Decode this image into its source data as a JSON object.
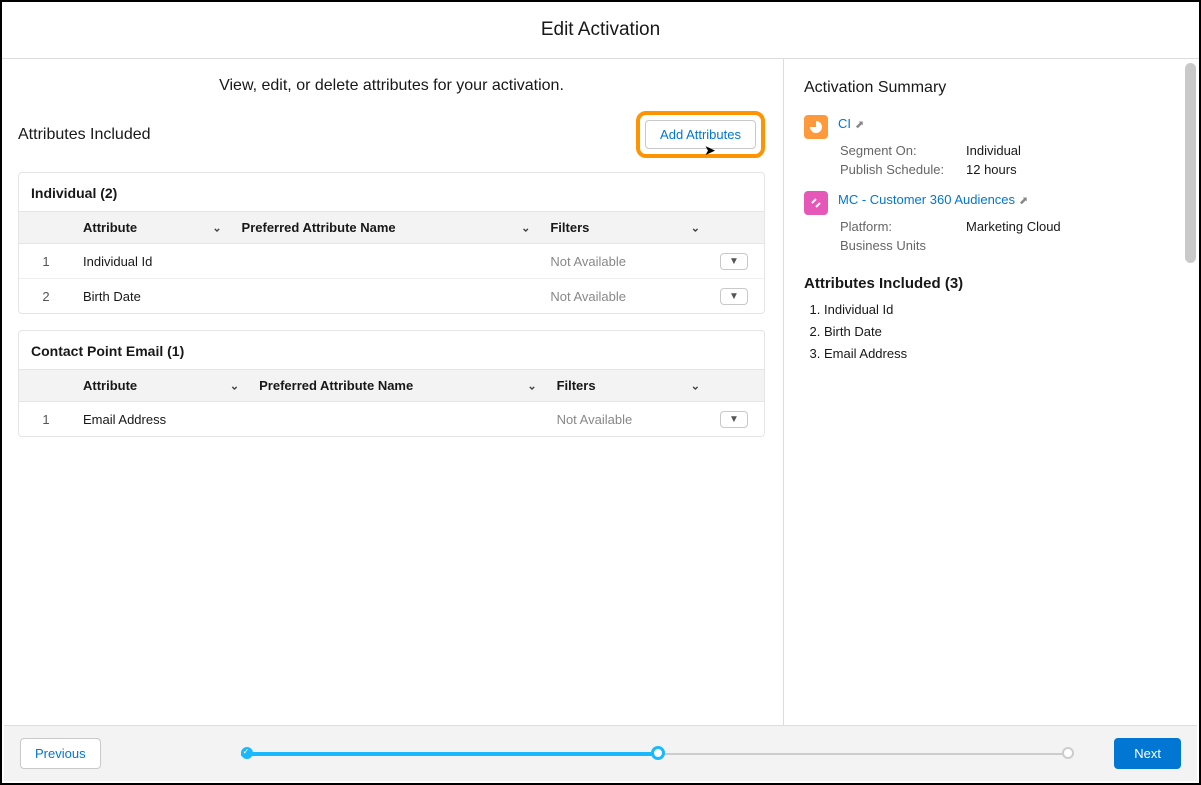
{
  "header": {
    "title": "Edit Activation"
  },
  "main": {
    "subtitle": "View, edit, or delete attributes for your activation.",
    "section_title": "Attributes Included",
    "add_button_label": "Add Attributes",
    "tables": [
      {
        "title": "Individual (2)",
        "columns": {
          "attribute": "Attribute",
          "preferred": "Preferred Attribute Name",
          "filters": "Filters"
        },
        "rows": [
          {
            "num": "1",
            "attribute": "Individual Id",
            "preferred": "",
            "filters": "Not Available"
          },
          {
            "num": "2",
            "attribute": "Birth Date",
            "preferred": "",
            "filters": "Not Available"
          }
        ]
      },
      {
        "title": "Contact Point Email (1)",
        "columns": {
          "attribute": "Attribute",
          "preferred": "Preferred Attribute Name",
          "filters": "Filters"
        },
        "rows": [
          {
            "num": "1",
            "attribute": "Email Address",
            "preferred": "",
            "filters": "Not Available"
          }
        ]
      }
    ]
  },
  "sidebar": {
    "title": "Activation Summary",
    "link1": "CI",
    "segment_on_label": "Segment On:",
    "segment_on_value": "Individual",
    "publish_label": "Publish Schedule:",
    "publish_value": "12 hours",
    "link2": "MC - Customer 360 Audiences",
    "platform_label": "Platform:",
    "platform_value": "Marketing Cloud",
    "bu_label": "Business Units",
    "attrs_title": "Attributes Included (3)",
    "attrs": [
      "Individual Id",
      "Birth Date",
      "Email Address"
    ]
  },
  "footer": {
    "previous": "Previous",
    "next": "Next"
  }
}
